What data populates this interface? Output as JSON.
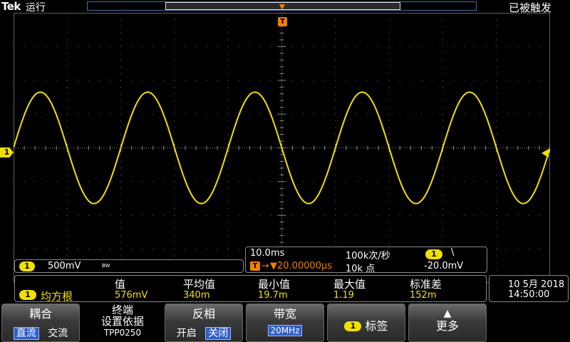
{
  "header": {
    "logo": "Tek",
    "run_state": "运行",
    "trigger_status": "已被触发",
    "trigger_marker": "T"
  },
  "channel1": {
    "badge": "1",
    "scale": "500mV",
    "bw_symbol": "BW",
    "color": "#f0e000"
  },
  "horizontal": {
    "time_div": "10.0ms",
    "sample_rate": "100k次/秒",
    "record_length": "10k 点",
    "trigger_delay": "▼20.00000μs",
    "trigger_source_badge": "1",
    "trigger_slope": "\\",
    "trigger_level": "-20.0mV"
  },
  "measurements": {
    "headers": [
      "值",
      "平均值",
      "最小值",
      "最大值",
      "标准差"
    ],
    "row": {
      "badge": "1",
      "name": "均方根",
      "value": "576mV",
      "mean": "340m",
      "min": "19.7m",
      "max": "1.19",
      "stddev": "152m"
    }
  },
  "datetime": {
    "date": "10 5月 2018",
    "time": "14:50:00"
  },
  "menu": {
    "coupling": {
      "title": "耦合",
      "opt_dc": "直流",
      "opt_ac": "交流"
    },
    "termination": {
      "line1": "终端",
      "line2": "设置依据",
      "line3": "TPP0250"
    },
    "invert": {
      "title": "反相",
      "opt_on": "开启",
      "opt_off": "关闭"
    },
    "bandwidth": {
      "title": "带宽",
      "value": "20MHz"
    },
    "label": {
      "badge": "1",
      "title": "标签"
    },
    "more": {
      "title": "更多",
      "arrow": "▲"
    }
  },
  "waveform": {
    "cycles_on_screen": 5,
    "amplitude_div": 1.65,
    "color": "#f0e000"
  }
}
